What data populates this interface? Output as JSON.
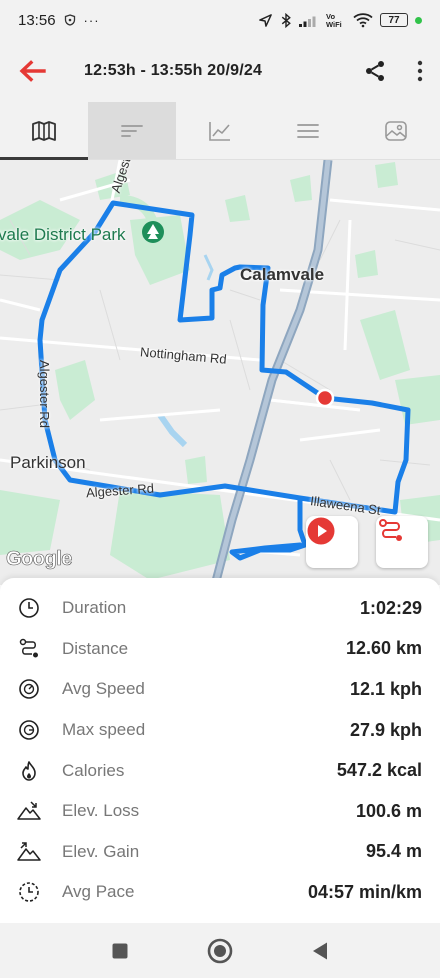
{
  "status_bar": {
    "time": "13:56",
    "battery": "77"
  },
  "header": {
    "title": "12:53h - 13:55h  20/9/24"
  },
  "tabs": [
    {
      "icon": "map-icon",
      "active": true
    },
    {
      "icon": "list-lines-icon",
      "pressed": true
    },
    {
      "icon": "chart-icon"
    },
    {
      "icon": "menu-lines-icon"
    },
    {
      "icon": "photo-icon"
    }
  ],
  "map": {
    "labels": {
      "park": "vale District Park",
      "calamvale": "Calamvale",
      "nottingham": "Nottingham Rd",
      "parkinson": "Parkinson",
      "algester_rd": "Algester Rd",
      "algester_rd_vertical": "Algester Rd",
      "algester_top": "Algeste",
      "illaweena": "Illaweena St"
    },
    "attribution": "Google",
    "route_color": "#1a7fe8",
    "marker_color": "#e53935"
  },
  "stats": [
    {
      "icon": "duration-icon",
      "label": "Duration",
      "value": "1:02:29"
    },
    {
      "icon": "distance-icon",
      "label": "Distance",
      "value": "12.60 km"
    },
    {
      "icon": "speed-icon",
      "label": "Avg Speed",
      "value": "12.1 kph"
    },
    {
      "icon": "max-speed-icon",
      "label": "Max speed",
      "value": "27.9 kph"
    },
    {
      "icon": "calories-icon",
      "label": "Calories",
      "value": "547.2 kcal"
    },
    {
      "icon": "elevation-loss-icon",
      "label": "Elev. Loss",
      "value": "100.6 m"
    },
    {
      "icon": "elevation-gain-icon",
      "label": "Elev. Gain",
      "value": "95.4 m"
    },
    {
      "icon": "pace-icon",
      "label": "Avg Pace",
      "value": "04:57 min/km"
    }
  ],
  "colors": {
    "accent_red": "#e53935",
    "route_blue": "#1a7fe8"
  }
}
